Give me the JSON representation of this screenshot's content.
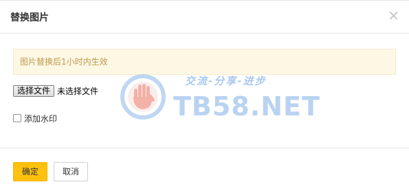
{
  "dialog": {
    "title": "替换图片",
    "close_icon": "close-icon"
  },
  "notice": {
    "text": "图片替换后1小时内生效"
  },
  "file_input": {
    "button_label": "选择文件",
    "status": "未选择文件"
  },
  "watermark_checkbox": {
    "label": "添加水印",
    "checked": false
  },
  "footer": {
    "ok_label": "确定",
    "cancel_label": "取消"
  },
  "watermark_overlay": {
    "tagline": "交流-分享-进步",
    "brand": "TB58.NET",
    "logo_icon": "hand-logo-icon"
  },
  "colors": {
    "primary_button": "#ffc10e",
    "notice_bg": "#fcf8e3",
    "notice_text": "#c09853",
    "watermark": "#b9d3f1"
  }
}
